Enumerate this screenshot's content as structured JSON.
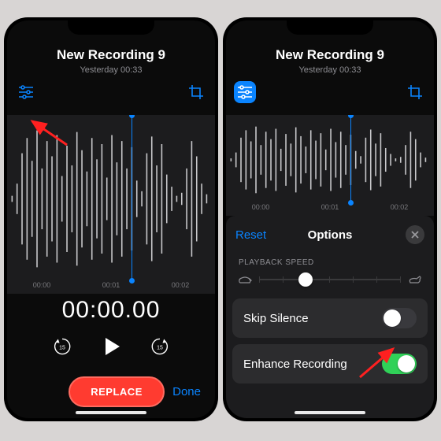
{
  "left": {
    "title": "New Recording 9",
    "subtitle": "Yesterday  00:33",
    "ticks": [
      "00:00",
      "00:01",
      "00:02"
    ],
    "time": "00:00.00",
    "skip_back": "15",
    "skip_fwd": "15",
    "replace": "REPLACE",
    "done": "Done"
  },
  "right": {
    "title": "New Recording 9",
    "subtitle": "Yesterday  00:33",
    "ticks": [
      "00:00",
      "00:01",
      "00:02"
    ]
  },
  "sheet": {
    "reset": "Reset",
    "title": "Options",
    "section": "PLAYBACK SPEED",
    "skip_silence": "Skip Silence",
    "enhance": "Enhance Recording",
    "skip_silence_on": false,
    "enhance_on": true
  },
  "colors": {
    "accent": "#0a84ff",
    "danger": "#ff3b30",
    "green": "#30d158"
  }
}
